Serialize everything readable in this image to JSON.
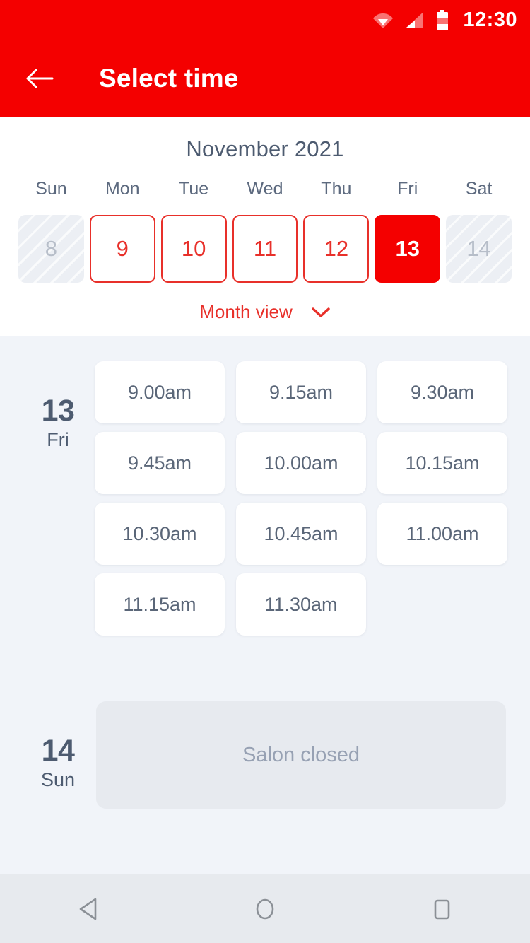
{
  "status_bar": {
    "time": "12:30",
    "icons": [
      "wifi-icon",
      "signal-icon",
      "battery-icon"
    ]
  },
  "app_bar": {
    "back_icon": "arrow-left-icon",
    "title": "Select time"
  },
  "theme": {
    "accent": "#f40000",
    "accent_border": "#e8302a",
    "text_dark": "#4d5b70",
    "text_muted": "#97a1b3",
    "surface": "#ffffff",
    "background": "#f1f4f9",
    "disabled_surface": "#eceff4"
  },
  "calendar": {
    "month_label": "November 2021",
    "weekdays": [
      "Sun",
      "Mon",
      "Tue",
      "Wed",
      "Thu",
      "Fri",
      "Sat"
    ],
    "days": [
      {
        "number": "8",
        "state": "disabled"
      },
      {
        "number": "9",
        "state": "available"
      },
      {
        "number": "10",
        "state": "available"
      },
      {
        "number": "11",
        "state": "available"
      },
      {
        "number": "12",
        "state": "available"
      },
      {
        "number": "13",
        "state": "selected"
      },
      {
        "number": "14",
        "state": "disabled"
      }
    ],
    "month_view_label": "Month view",
    "month_view_icon": "chevron-down-icon"
  },
  "schedule": [
    {
      "day_number": "13",
      "day_name": "Fri",
      "slots": [
        "9.00am",
        "9.15am",
        "9.30am",
        "9.45am",
        "10.00am",
        "10.15am",
        "10.30am",
        "10.45am",
        "11.00am",
        "11.15am",
        "11.30am"
      ]
    },
    {
      "day_number": "14",
      "day_name": "Sun",
      "closed_label": "Salon closed"
    }
  ],
  "nav_bar": {
    "back": "nav-back-icon",
    "home": "nav-home-icon",
    "recents": "nav-recents-icon"
  }
}
